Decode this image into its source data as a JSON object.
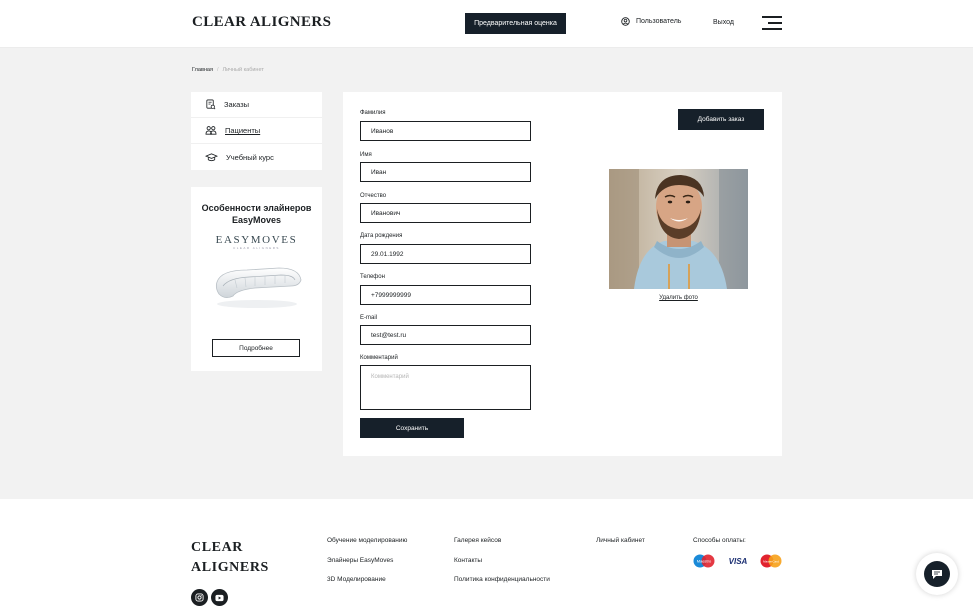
{
  "header": {
    "logo": "CLEAR ALIGNERS",
    "estimate_button": "Предварительная оценка",
    "user_link": "Пользователь",
    "logout_link": "Выход"
  },
  "breadcrumb": {
    "home": "Главная",
    "separator": "/",
    "current": "Личный кабинет"
  },
  "sidebar": {
    "items": [
      {
        "label": "Заказы",
        "icon": "orders-icon"
      },
      {
        "label": "Пациенты",
        "icon": "patients-icon",
        "active": true
      },
      {
        "label": "Учебный курс",
        "icon": "graduation-cap-icon"
      }
    ],
    "promo": {
      "title": "Особенности элайнеров EasyMoves",
      "brand": "EASYMOVES",
      "brand_sub": "CLEAR ALIGNERS",
      "button": "Подробнее"
    }
  },
  "form": {
    "fields": [
      {
        "label": "Фамилия",
        "value": "Иванов"
      },
      {
        "label": "Имя",
        "value": "Иван"
      },
      {
        "label": "Отчество",
        "value": "Иванович"
      },
      {
        "label": "Дата рождения",
        "value": "29.01.1992"
      },
      {
        "label": "Телефон",
        "value": "+7999999999"
      },
      {
        "label": "E-mail",
        "value": "test@test.ru"
      }
    ],
    "comment": {
      "label": "Комментарий",
      "placeholder": "Комментарий"
    },
    "save_button": "Сохранить",
    "add_order_button": "Добавить заказ",
    "delete_photo": "Удалить фото"
  },
  "footer": {
    "logo_line1": "CLEAR",
    "logo_line2": "ALIGNERS",
    "col1": [
      "Обучение моделированию",
      "Элайнеры EasyMoves",
      "3D Моделирование"
    ],
    "col2": [
      "Галерея кейсов",
      "Контакты",
      "Политика конфиденциальности"
    ],
    "col3": [
      "Личный кабинет"
    ],
    "payment_title": "Способы оплаты:",
    "payment_methods": [
      "Maestro",
      "VISA",
      "MasterCard"
    ]
  },
  "colors": {
    "accent": "#16202a",
    "page_bg": "#f2f2f2",
    "card_bg": "#ffffff"
  }
}
